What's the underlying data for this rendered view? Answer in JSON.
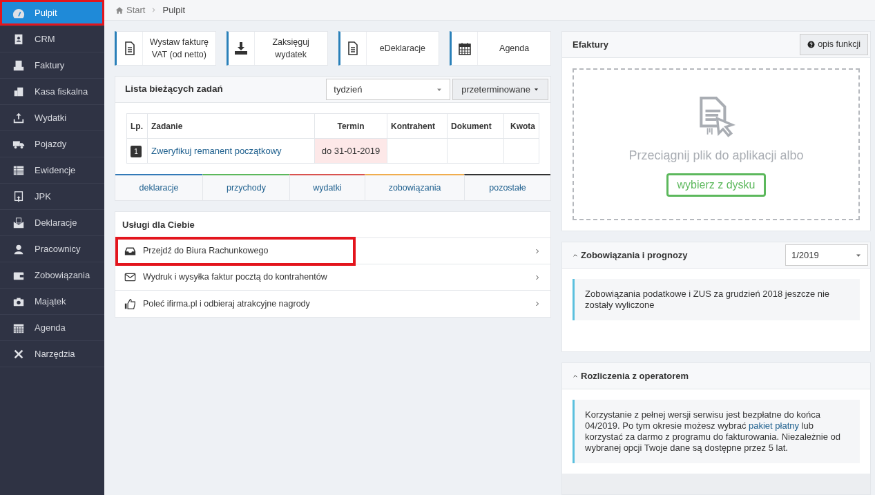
{
  "sidebar": {
    "items": [
      {
        "label": "Pulpit",
        "selected": true,
        "highlighted": true
      },
      {
        "label": "CRM",
        "selected": false,
        "highlighted": false
      },
      {
        "label": "Faktury",
        "selected": false,
        "highlighted": false
      },
      {
        "label": "Kasa fiskalna",
        "selected": false,
        "highlighted": false
      },
      {
        "label": "Wydatki",
        "selected": false,
        "highlighted": false
      },
      {
        "label": "Pojazdy",
        "selected": false,
        "highlighted": false
      },
      {
        "label": "Ewidencje",
        "selected": false,
        "highlighted": false
      },
      {
        "label": "JPK",
        "selected": false,
        "highlighted": false
      },
      {
        "label": "Deklaracje",
        "selected": false,
        "highlighted": false
      },
      {
        "label": "Pracownicy",
        "selected": false,
        "highlighted": false
      },
      {
        "label": "Zobowiązania",
        "selected": false,
        "highlighted": false
      },
      {
        "label": "Majątek",
        "selected": false,
        "highlighted": false
      },
      {
        "label": "Agenda",
        "selected": false,
        "highlighted": false
      },
      {
        "label": "Narzędzia",
        "selected": false,
        "highlighted": false
      }
    ]
  },
  "breadcrumb": [
    "Start",
    "Pulpit"
  ],
  "quick_actions": [
    "Wystaw fakturę VAT (od netto)",
    "Zaksięguj wydatek",
    "eDeklaracje",
    "Agenda"
  ],
  "tasks": {
    "title": "Lista bieżących zadań",
    "period": "tydzień",
    "filter": "przeterminowane",
    "columns": [
      "Lp.",
      "Zadanie",
      "Termin",
      "Kontrahent",
      "Dokument",
      "Kwota"
    ],
    "rows": [
      {
        "number": "1",
        "task": "Zweryfikuj remanent początkowy",
        "due": "do 31-01-2019",
        "overdue": true,
        "contractor": "",
        "document": "",
        "amount": ""
      }
    ],
    "tabs": [
      {
        "label": "deklaracje",
        "color": "#337ab7"
      },
      {
        "label": "przychody",
        "color": "#5cb85c"
      },
      {
        "label": "wydatki",
        "color": "#d9534f"
      },
      {
        "label": "zobowiązania",
        "color": "#f0ad4e"
      },
      {
        "label": "pozostałe",
        "color": "#333333"
      }
    ]
  },
  "services": {
    "title": "Usługi dla Ciebie",
    "items": [
      {
        "label": "Przejdź do Biura Rachunkowego",
        "highlighted": true
      },
      {
        "label": "Wydruk i wysyłka faktur pocztą do kontrahentów",
        "highlighted": false
      },
      {
        "label": "Poleć ifirma.pl i odbieraj atrakcyjne nagrody",
        "highlighted": false
      }
    ]
  },
  "efaktury": {
    "title": "Efaktury",
    "help_button": "opis funkcji",
    "drop_text": "Przeciągnij plik do aplikacji albo",
    "choose_button": "wybierz z dysku"
  },
  "liabilities": {
    "title": "Zobowiązania i prognozy",
    "period": "1/2019",
    "message": "Zobowiązania podatkowe i ZUS za grudzień 2018 jeszcze nie zostały wyliczone"
  },
  "operator": {
    "title": "Rozliczenia z operatorem",
    "message_before": "Korzystanie z pełnej wersji serwisu jest bezpłatne do końca 04/2019. Po tym okresie możesz wybrać",
    "link": "pakiet płatny",
    "message_after": "lub korzystać za darmo z programu do fakturowania. Niezależnie od wybranej opcji Twoje dane są dostępne przez 5 lat."
  }
}
